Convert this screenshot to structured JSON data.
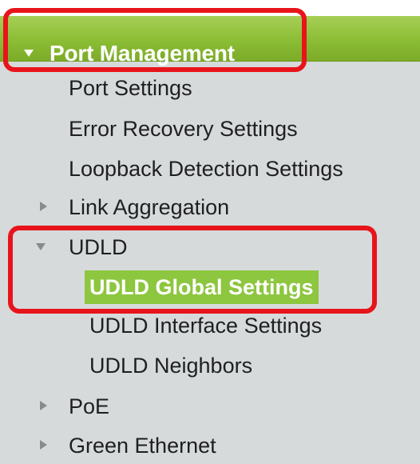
{
  "nav": {
    "header": {
      "title": "Port Management"
    },
    "items": [
      {
        "label": "Port Settings"
      },
      {
        "label": "Error Recovery Settings"
      },
      {
        "label": "Loopback Detection Settings"
      },
      {
        "label": "Link Aggregation"
      },
      {
        "label": "UDLD"
      },
      {
        "label": "UDLD Global Settings",
        "selected": true
      },
      {
        "label": "UDLD Interface Settings"
      },
      {
        "label": "UDLD Neighbors"
      },
      {
        "label": "PoE"
      },
      {
        "label": "Green Ethernet"
      }
    ]
  },
  "colors": {
    "header_green": "#8bbd35",
    "selected_green": "#8dc63f",
    "highlight_red": "#e8141b",
    "nav_background": "#d6dadb"
  },
  "icons": {
    "expanded": "triangle-down-icon",
    "collapsed": "triangle-right-icon"
  }
}
